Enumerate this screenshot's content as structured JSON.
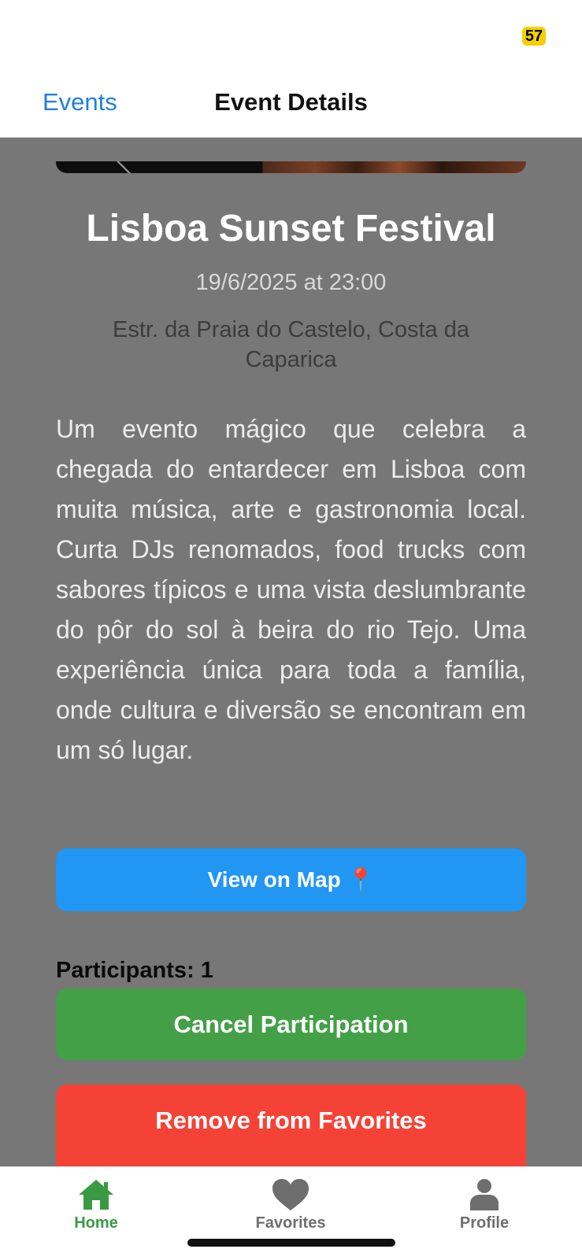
{
  "status_bar": {
    "badge": "57",
    "badge_color": "#f5d000"
  },
  "nav": {
    "back_label": "Events",
    "title": "Event Details",
    "back_color": "#1e7fe0"
  },
  "event": {
    "title": "Lisboa Sunset Festival",
    "datetime": "19/6/2025 at 23:00",
    "location": "Estr. da Praia do Castelo,  Costa da Caparica",
    "description": "Um evento mágico que celebra a chegada do entardecer em Lisboa com muita música, arte e gastronomia local. Curta DJs renomados, food trucks com sabores típicos e uma vista deslumbrante do pôr do sol à beira do rio Tejo. Uma experiência única para toda a família, onde cultura e diversão se encontram em um só lugar."
  },
  "actions": {
    "map_label": "View on Map",
    "map_icon": "📍",
    "participants_label": "Participants: 1",
    "cancel_label": "Cancel Participation",
    "remove_favorite_label": "Remove from Favorites"
  },
  "colors": {
    "map_button": "#2196f3",
    "cancel_button": "#43a047",
    "remove_button": "#f44336",
    "active_tab": "#3a9a44",
    "inactive_tab": "#6e6e6e"
  },
  "tab_bar": {
    "items": [
      {
        "label": "Home",
        "icon": "home-icon",
        "active": true
      },
      {
        "label": "Favorites",
        "icon": "heart-icon",
        "active": false
      },
      {
        "label": "Profile",
        "icon": "person-icon",
        "active": false
      }
    ]
  }
}
